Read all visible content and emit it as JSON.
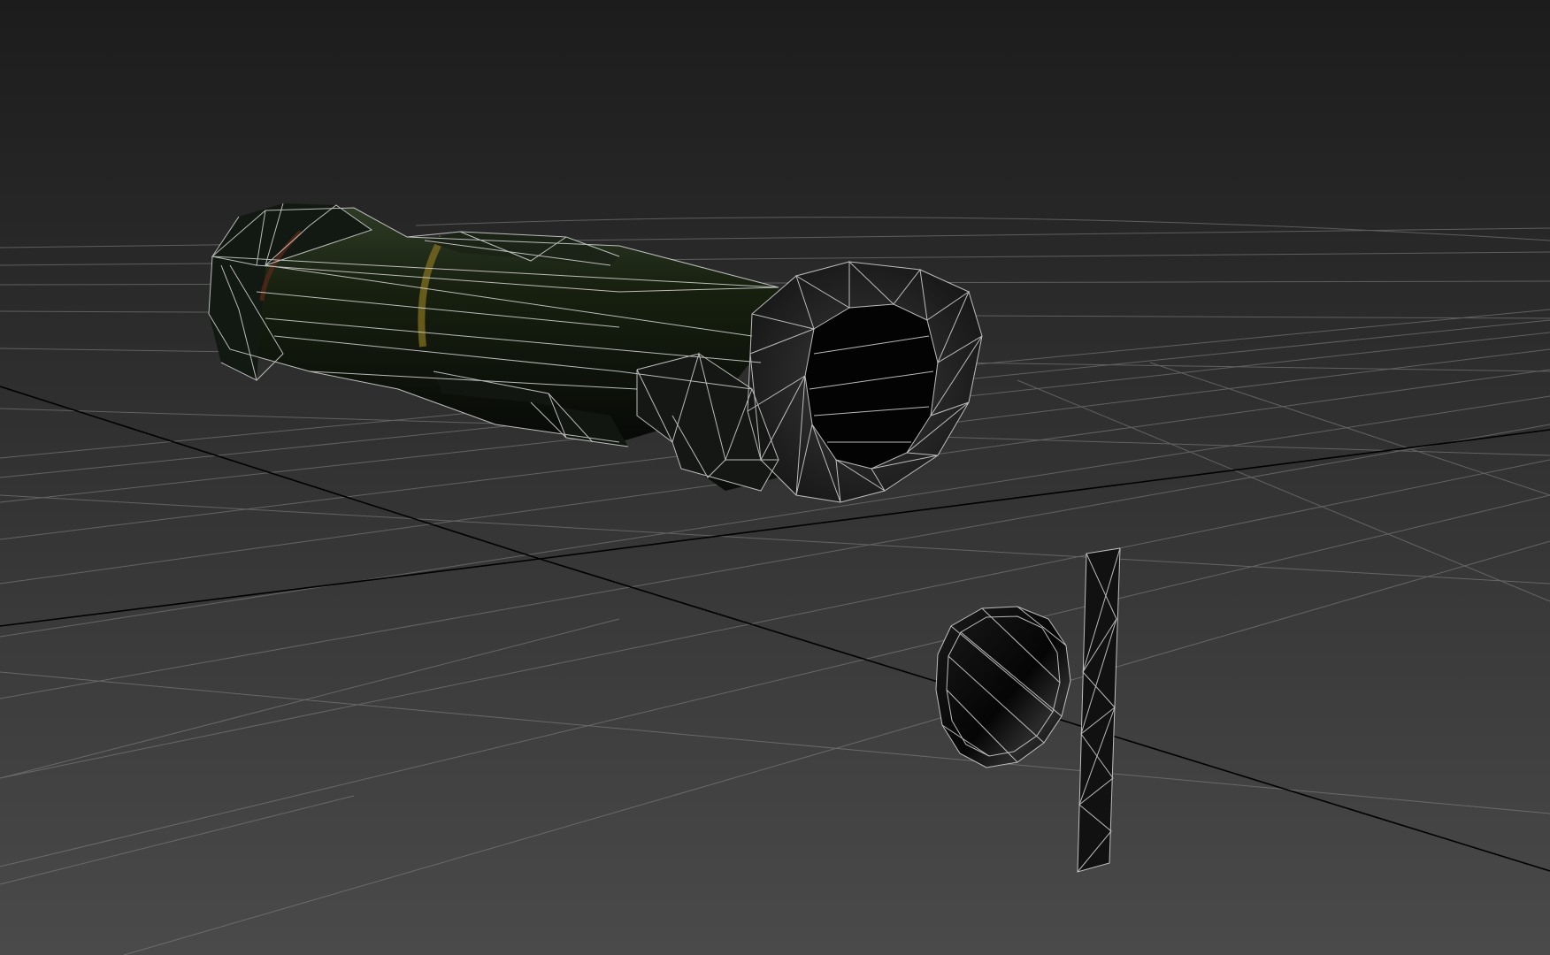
{
  "viewport": {
    "view_type": "perspective",
    "shading": "shaded-with-wireframe",
    "background_gradient": [
      "#1c1c1c",
      "#4a4a4a"
    ],
    "grid_color": "#8a8a8a",
    "axis_line_color": "#000000",
    "wire_color": "#d8d8d8"
  },
  "scene": {
    "objects": [
      {
        "name": "launcher-tube",
        "color": "#0e140e",
        "accent_color": "#7a6a1e"
      },
      {
        "name": "lens-disc",
        "color": "#0d0d0d"
      },
      {
        "name": "flat-plane",
        "color": "#111111"
      }
    ]
  }
}
